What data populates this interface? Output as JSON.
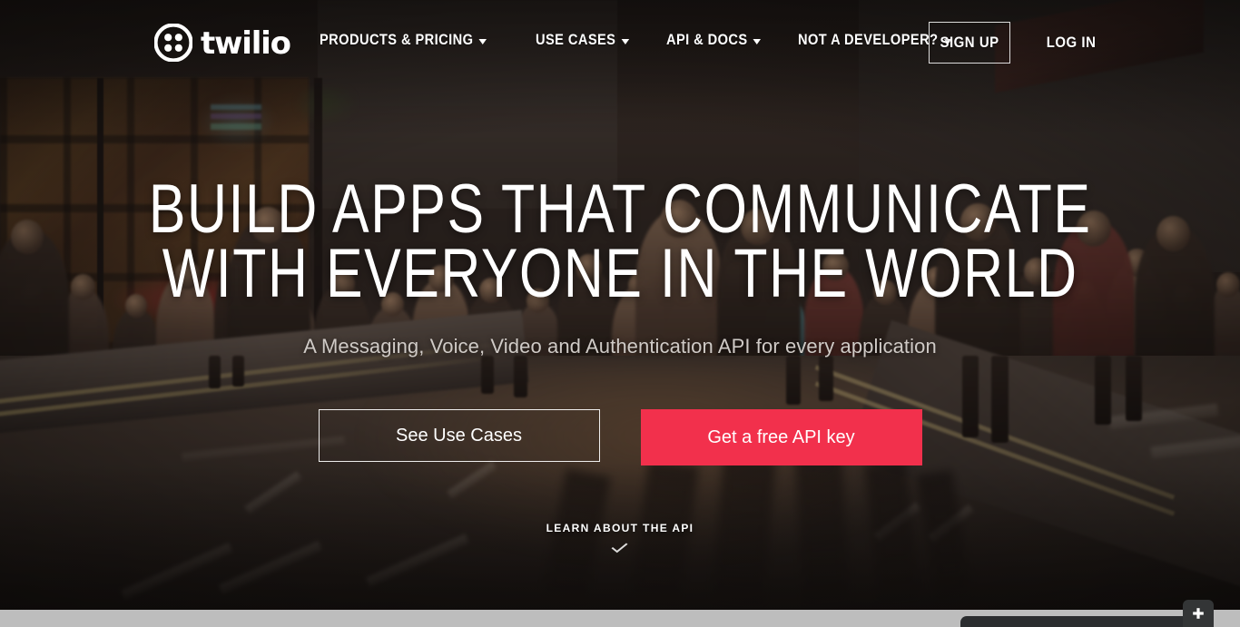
{
  "brand": {
    "name": "twilio",
    "logo_icon": "twilio-dots-logo-icon",
    "accent_color": "#f2304c",
    "page_bg_color": "#bdbdbd"
  },
  "header": {
    "nav": [
      {
        "label": "PRODUCTS & PRICING",
        "has_dropdown": true,
        "icon": "caret-down-icon"
      },
      {
        "label": "USE CASES",
        "has_dropdown": true,
        "icon": "caret-down-icon"
      },
      {
        "label": "API & DOCS",
        "has_dropdown": true,
        "icon": "caret-down-icon"
      },
      {
        "label": "NOT A DEVELOPER?",
        "has_dropdown": true,
        "icon": "caret-down-icon"
      }
    ],
    "sign_up_label": "SIGN UP",
    "log_in_label": "LOG IN"
  },
  "hero": {
    "headline_line1": "BUILD APPS THAT COMMUNICATE",
    "headline_line2": "WITH EVERYONE IN THE WORLD",
    "subheadline": "A Messaging, Voice, Video and Authentication API for every application",
    "cta_secondary": "See Use Cases",
    "cta_primary": "Get a free API key",
    "scroll_label": "LEARN ABOUT THE API",
    "scroll_icon": "chevron-down-icon",
    "background_image": "street-crowd-photo"
  },
  "chat_widget": {
    "expand_icon": "plus-icon"
  }
}
